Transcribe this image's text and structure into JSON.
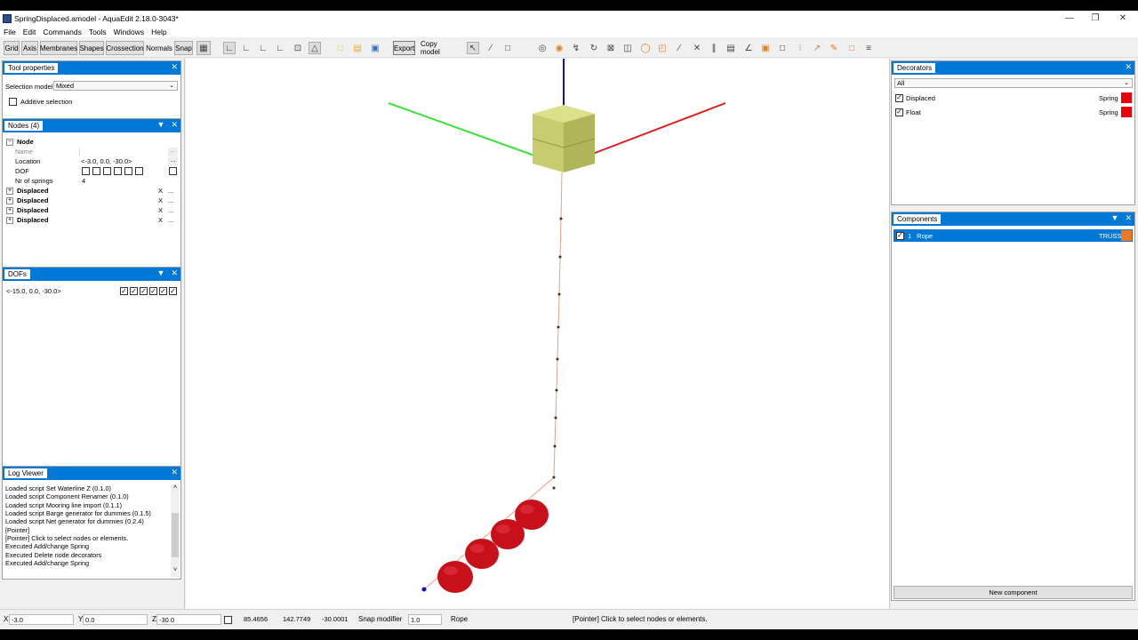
{
  "window": {
    "title": "SpringDisplaced.amodel - AquaEdit 2.18.0-3043*"
  },
  "menu": [
    "File",
    "Edit",
    "Commands",
    "Tools",
    "Windows",
    "Help"
  ],
  "toolbar": {
    "buttons": [
      "Grid",
      "Axis",
      "Membranes",
      "Shapes",
      "Crossection",
      "Normals",
      "Snap"
    ],
    "export_label": "Export",
    "copy_model_label": "Copy model"
  },
  "tool_properties": {
    "title": "Tool properties",
    "selection_model_label": "Selection model",
    "selection_model_value": "Mixed",
    "additive_selection_label": "Additive selection"
  },
  "nodes_panel": {
    "title": "Nodes (4)",
    "node_header": "Node",
    "name_label": "Name",
    "location_label": "Location",
    "location_value": "<-3.0, 0.0, -30.0>",
    "dof_label": "DOF",
    "nr_springs_label": "Nr of springs",
    "nr_springs_value": "4",
    "decorators": [
      "Displaced",
      "Displaced",
      "Displaced",
      "Displaced"
    ],
    "remove_label": "X",
    "more_label": "..."
  },
  "dofs_panel": {
    "title": "DOFs",
    "value": "<-15.0, 0.0, -30.0>"
  },
  "log_viewer": {
    "title": "Log Viewer",
    "lines": [
      "Loaded script Set Waterline Z (0.1.0)",
      "Loaded script Component Renamer (0.1.0)",
      "Loaded script Mooring line import (0.1.1)",
      "Loaded script Barge generator for dummies (0.1.5)",
      "Loaded script Net generator for dummies (0.2.4)",
      "[Pointer]",
      "[Pointer] Click to select nodes or elements.",
      "Executed Add/change Spring",
      "Executed Delete node decorators",
      "Executed Add/change Spring"
    ]
  },
  "decorators_panel": {
    "title": "Decorators",
    "filter_value": "All",
    "items": [
      {
        "name": "Displaced",
        "type": "Spring",
        "color": "#e8000b"
      },
      {
        "name": "Float",
        "type": "Spring",
        "color": "#e8000b"
      }
    ]
  },
  "components_panel": {
    "title": "Components",
    "items": [
      {
        "index": "1",
        "name": "Rope",
        "type": "TRUSS",
        "color": "#f07820"
      }
    ],
    "new_component_label": "New component"
  },
  "statusbar": {
    "x_label": "X",
    "x_value": "-3.0",
    "y_label": "Y",
    "y_value": "0.0",
    "z_label": "Z",
    "z_value": "-30.0",
    "coord1": "85.4656",
    "coord2": "142.7749",
    "coord3": "-30.0001",
    "snap_modifier_label": "Snap modifier",
    "snap_modifier_value": "1.0",
    "component": "Rope",
    "message": "[Pointer] Click to select nodes or elements."
  },
  "colors": {
    "accent": "#0078d7",
    "axis_x": "#e02020",
    "axis_y": "#3ee03e",
    "axis_z": "#1010c0",
    "box": "#c7cc6e",
    "float": "#c8101a"
  }
}
